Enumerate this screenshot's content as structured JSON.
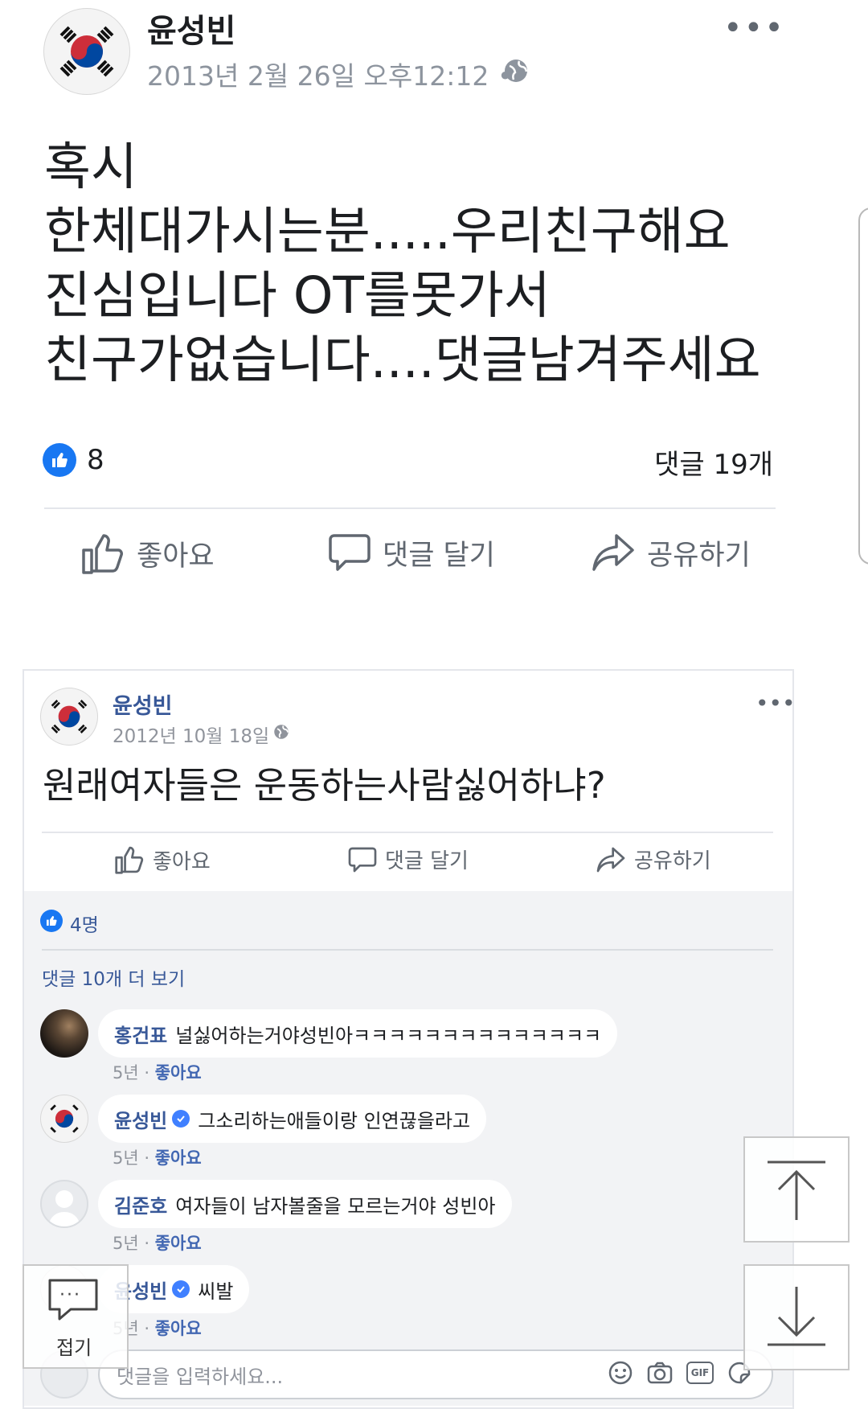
{
  "post1": {
    "author": "윤성빈",
    "date": "2013년 2월 26일 오후12:12 •",
    "more_label": "•••",
    "body": "혹시\n한체대가시는분.....우리친구해요\n진심입니다 OT를못가서\n친구가없습니다....댓글남겨주세요",
    "like_count": "8",
    "comment_count": "댓글 19개",
    "actions": {
      "like": "좋아요",
      "comment": "댓글 달기",
      "share": "공유하기"
    }
  },
  "post2": {
    "author": "윤성빈",
    "date": "2012년 10월 18일 ·",
    "more_label": "•••",
    "body": "원래여자들은 운동하는사람싫어하냐?",
    "actions": {
      "like": "좋아요",
      "comment": "댓글 달기",
      "share": "공유하기"
    },
    "like_count": "4명",
    "more_comments": "댓글 10개 더 보기",
    "comments": [
      {
        "author": "홍건표",
        "text": "널싫어하는거야성빈아ㅋㅋㅋㅋㅋㅋㅋㅋㅋㅋㅋㅋㅋㅋ",
        "time": "5년 · ",
        "like": "좋아요",
        "verified": false
      },
      {
        "author": "윤성빈",
        "text": "그소리하는애들이랑 인연끊을라고",
        "time": "5년 · ",
        "like": "좋아요",
        "verified": true
      },
      {
        "author": "김준호",
        "text": "여자들이 남자볼줄을 모르는거야 성빈아",
        "time": "5년 · ",
        "like": "좋아요",
        "verified": false
      },
      {
        "author": "윤성빈",
        "text": "씨발",
        "time": "5년 · ",
        "like": "좋아요",
        "verified": true
      }
    ],
    "input_placeholder": "댓글을 입력하세요...",
    "input_icons": [
      "smile-icon",
      "camera-icon",
      "gif-icon",
      "sticker-icon"
    ],
    "gif_label": "GIF"
  },
  "overlay": {
    "fold_label": "접기",
    "fold_dots": "···"
  },
  "colors": {
    "facebook_blue": "#1877f2",
    "link_blue": "#385898",
    "comments_bg": "#f2f3f5"
  }
}
